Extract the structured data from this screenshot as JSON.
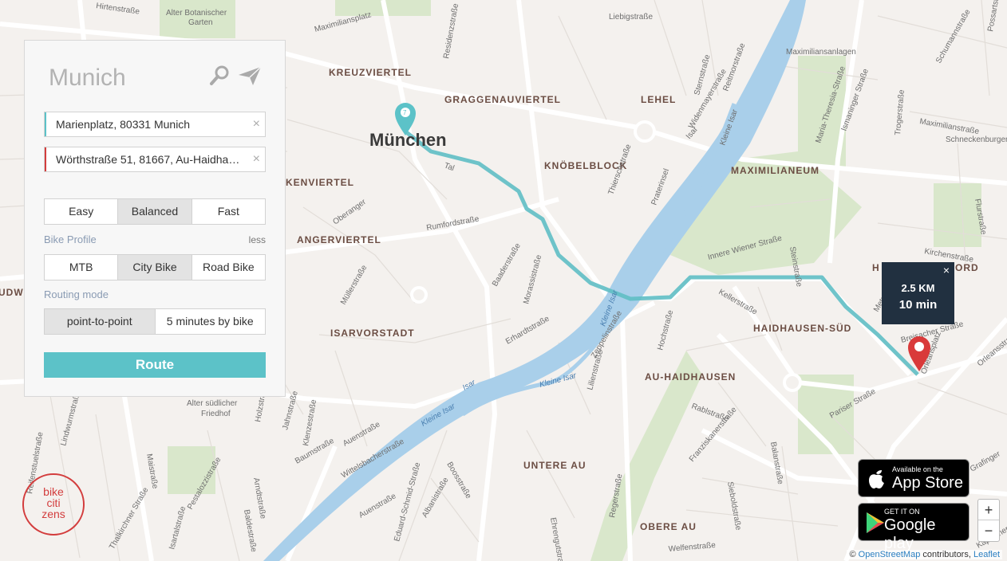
{
  "map": {
    "districts": [
      {
        "name": "KREUZVIERTEL"
      },
      {
        "name": "GRAGGENAUVIERTEL"
      },
      {
        "name": "LEHEL"
      },
      {
        "name": "KNÖBELBLOCK"
      },
      {
        "name": "KENVIERTEL"
      },
      {
        "name": "ANGERVIERTEL"
      },
      {
        "name": "MAXIMILIANEUM"
      },
      {
        "name": "ISARVORSTADT"
      },
      {
        "name": "HAIDHAUSEN-SÜD"
      },
      {
        "name": "AU-HAIDHAUSEN"
      },
      {
        "name": "UNTERE AU"
      },
      {
        "name": "OBERE AU"
      },
      {
        "name": "H"
      },
      {
        "name": "ORD"
      },
      {
        "name": "UDW"
      }
    ],
    "city_label": "München",
    "streets": [
      {
        "name": "Hirtenstraße"
      },
      {
        "name": "Alter Botanischer"
      },
      {
        "name": "Garten"
      },
      {
        "name": "Maximiliansplatz"
      },
      {
        "name": "Residenzstraße"
      },
      {
        "name": "Liebigstraße"
      },
      {
        "name": "Maximilianstraße"
      },
      {
        "name": "Maximiliansanlagen"
      },
      {
        "name": "Sternstraße"
      },
      {
        "name": "Widenmayerstraße"
      },
      {
        "name": "Reitmorstraße"
      },
      {
        "name": "Maria-Theresia-Straße"
      },
      {
        "name": "Ismaninger Straße"
      },
      {
        "name": "Schumannstraße"
      },
      {
        "name": "Possartstraße"
      },
      {
        "name": "Troger­straße"
      },
      {
        "name": "Schneckenburgerstraße"
      },
      {
        "name": "Tal"
      },
      {
        "name": "Thierschstraße"
      },
      {
        "name": "Praterinsel"
      },
      {
        "name": "Kleine Isar"
      },
      {
        "name": "Isar"
      },
      {
        "name": "Oberanger"
      },
      {
        "name": "Rumfordstraße"
      },
      {
        "name": "Baaderstraße"
      },
      {
        "name": "Morassistraße"
      },
      {
        "name": "Innere Wiener Straße"
      },
      {
        "name": "Steinstraße"
      },
      {
        "name": "Kirchenstraße"
      },
      {
        "name": "Flurstraße"
      },
      {
        "name": "Müllerstraße"
      },
      {
        "name": "Kellerstraße"
      },
      {
        "name": "Metzstraße"
      },
      {
        "name": "Erhardtstraße"
      },
      {
        "name": "Zeppelinstraße"
      },
      {
        "name": "Lilienstraße"
      },
      {
        "name": "Hochstraße"
      },
      {
        "name": "Breisacher Straße"
      },
      {
        "name": "Orleansplatz"
      },
      {
        "name": "Orleansstraße"
      },
      {
        "name": "Alter südlicher"
      },
      {
        "name": "Friedhof"
      },
      {
        "name": "Jahnstraße"
      },
      {
        "name": "Klenzestraße"
      },
      {
        "name": "Baumstraße"
      },
      {
        "name": "Auenstraße"
      },
      {
        "name": "Wittelsbacherstraße"
      },
      {
        "name": "Boosstraße"
      },
      {
        "name": "Eduard-Schmid-Straße"
      },
      {
        "name": "Albanistraße"
      },
      {
        "name": "Pariser Straße"
      },
      {
        "name": "Rablstraße"
      },
      {
        "name": "Franziskanerstraße"
      },
      {
        "name": "Balanstraße"
      },
      {
        "name": "Sieboldstraße"
      },
      {
        "name": "Regerstraße"
      },
      {
        "name": "Welfenstraße"
      },
      {
        "name": "Grafinger"
      },
      {
        "name": "Thalkirchner Straße"
      },
      {
        "name": "Pestalozzistraße"
      },
      {
        "name": "Isartalstraße"
      },
      {
        "name": "Baldestraße"
      },
      {
        "name": "Arndtstraße"
      },
      {
        "name": "Maistraße"
      },
      {
        "name": "Holzstraße"
      },
      {
        "name": "Lindwurmstraße"
      },
      {
        "name": "Kapuzinerstraße"
      },
      {
        "name": "Ehrengutstraße"
      },
      {
        "name": "Reifenstuelstraße"
      },
      {
        "name": "Auenstraße"
      }
    ],
    "colors": {
      "route": "#5fbec4",
      "river": "#a9cfea",
      "water_line": "#7fb5dd",
      "park": "#d7e6c8",
      "road": "#ffffff",
      "end_pin": "#d93a3a",
      "start_pin": "#5cc2c8"
    }
  },
  "panel": {
    "city": "Munich",
    "search_icon": "search-icon",
    "locate_icon": "send-icon",
    "origin": "Marienplatz, 80331 Munich",
    "destination": "Wörthstraße 51, 81667, Au-Haidhausen",
    "clear_icon": "close-icon",
    "clear_glyph": "×",
    "preference_options": [
      "Easy",
      "Balanced",
      "Fast"
    ],
    "preference_selected": "Balanced",
    "bike_profile_label": "Bike Profile",
    "less_label": "less",
    "bike_profile_options": [
      "MTB",
      "City Bike",
      "Road Bike"
    ],
    "bike_profile_selected": "City Bike",
    "routing_mode_label": "Routing mode",
    "routing_mode_options": [
      "point-to-point",
      "5 minutes by bike"
    ],
    "routing_mode_selected": "point-to-point",
    "route_button": "Route"
  },
  "route_info": {
    "distance": "2.5 KM",
    "time": "10 min",
    "close_glyph": "×"
  },
  "stores": {
    "apple_small": "Available on the",
    "apple_big": "App Store",
    "google_small": "GET IT ON",
    "google_big": "Google play"
  },
  "zoom": {
    "in": "+",
    "out": "−"
  },
  "attribution": {
    "prefix": "©",
    "osm": "OpenStreetMap",
    "middle": "contributors,",
    "leaflet": "Leaflet"
  },
  "logo": {
    "line1": "bike",
    "line2": "citi",
    "line3": "zens"
  }
}
